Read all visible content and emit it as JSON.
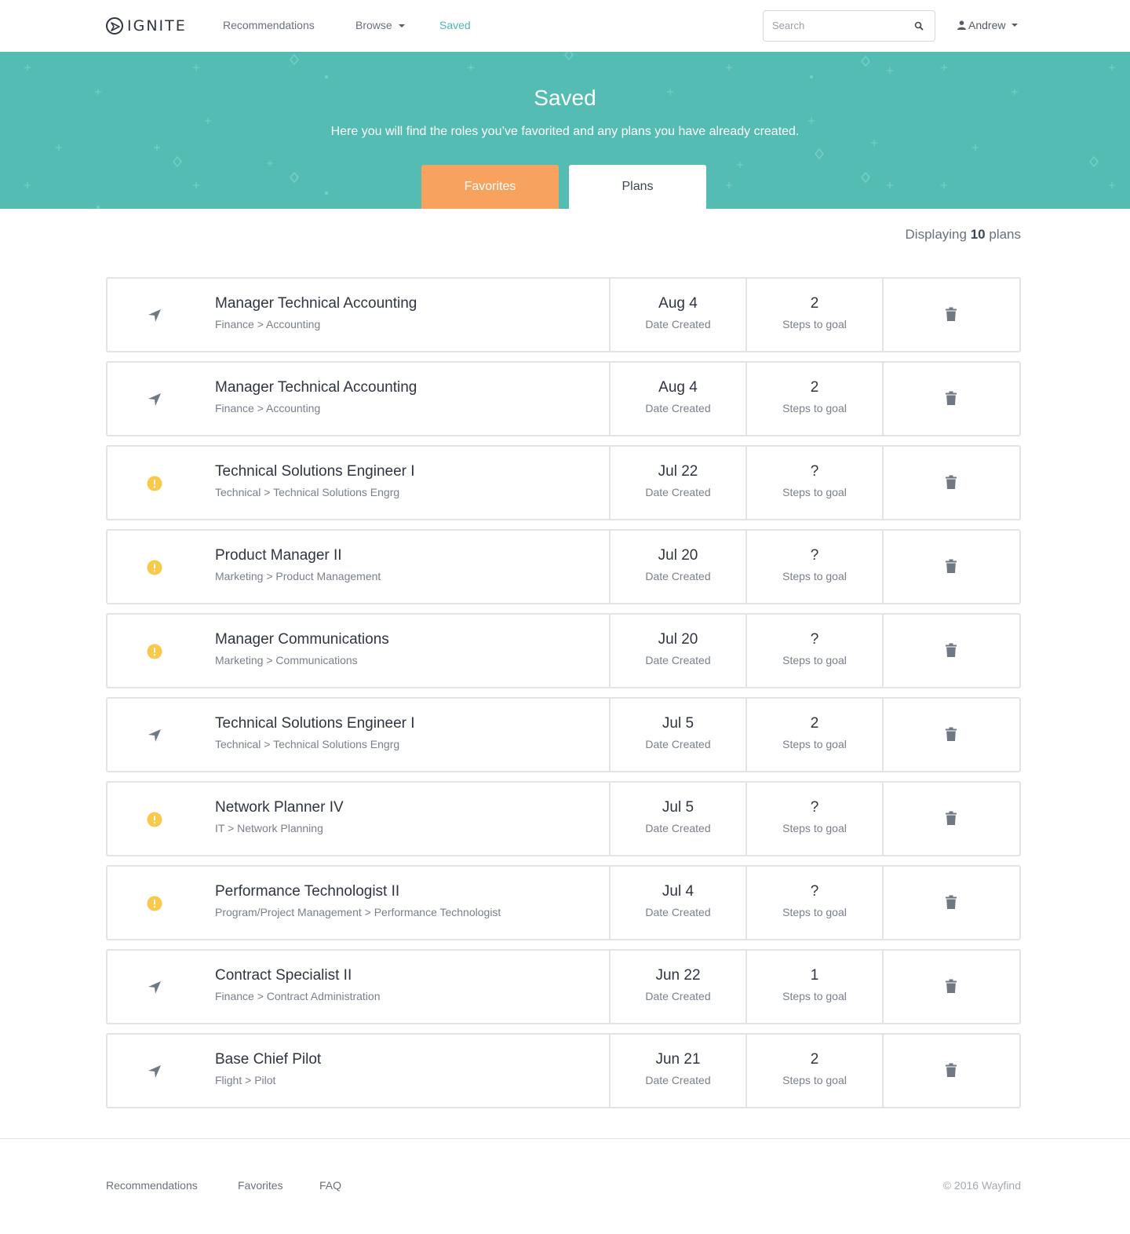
{
  "header": {
    "logo_text": "IGNITE",
    "nav": [
      {
        "label": "Recommendations"
      },
      {
        "label": "Browse"
      },
      {
        "label": "Saved"
      }
    ],
    "search_placeholder": "Search",
    "user_name": "Andrew"
  },
  "hero": {
    "title": "Saved",
    "subtitle": "Here you will find the roles you’ve favorited and any plans you have already created.",
    "tabs": [
      {
        "label": "Favorites",
        "active": false
      },
      {
        "label": "Plans",
        "active": true
      }
    ]
  },
  "summary": {
    "prefix": "Displaying",
    "count": "10",
    "suffix": "plans"
  },
  "plans": [
    {
      "status_icon": "navigation-arrow-icon",
      "title": "Manager Technical Accounting",
      "path": "Finance > Accounting",
      "date": "Aug 4",
      "date_label": "Date Created",
      "steps": "2",
      "steps_label": "Steps to goal"
    },
    {
      "status_icon": "navigation-arrow-icon",
      "title": "Manager Technical Accounting",
      "path": "Finance > Accounting",
      "date": "Aug 4",
      "date_label": "Date Created",
      "steps": "2",
      "steps_label": "Steps to goal"
    },
    {
      "status_icon": "warning-icon",
      "title": "Technical Solutions Engineer I",
      "path": "Technical > Technical Solutions Engrg",
      "date": "Jul 22",
      "date_label": "Date Created",
      "steps": "?",
      "steps_label": "Steps to goal"
    },
    {
      "status_icon": "warning-icon",
      "title": "Product Manager II",
      "path": "Marketing > Product Management",
      "date": "Jul 20",
      "date_label": "Date Created",
      "steps": "?",
      "steps_label": "Steps to goal"
    },
    {
      "status_icon": "warning-icon",
      "title": "Manager Communications",
      "path": "Marketing > Communications",
      "date": "Jul 20",
      "date_label": "Date Created",
      "steps": "?",
      "steps_label": "Steps to goal"
    },
    {
      "status_icon": "navigation-arrow-icon",
      "title": "Technical Solutions Engineer I",
      "path": "Technical > Technical Solutions Engrg",
      "date": "Jul 5",
      "date_label": "Date Created",
      "steps": "2",
      "steps_label": "Steps to goal"
    },
    {
      "status_icon": "warning-icon",
      "title": "Network Planner IV",
      "path": "IT > Network Planning",
      "date": "Jul 5",
      "date_label": "Date Created",
      "steps": "?",
      "steps_label": "Steps to goal"
    },
    {
      "status_icon": "warning-icon",
      "title": "Performance Technologist II",
      "path": "Program/Project Management > Performance Technologist",
      "date": "Jul 4",
      "date_label": "Date Created",
      "steps": "?",
      "steps_label": "Steps to goal"
    },
    {
      "status_icon": "navigation-arrow-icon",
      "title": "Contract Specialist II",
      "path": "Finance > Contract Administration",
      "date": "Jun 22",
      "date_label": "Date Created",
      "steps": "1",
      "steps_label": "Steps to goal"
    },
    {
      "status_icon": "navigation-arrow-icon",
      "title": "Base Chief Pilot",
      "path": "Flight > Pilot",
      "date": "Jun 21",
      "date_label": "Date Created",
      "steps": "2",
      "steps_label": "Steps to goal"
    }
  ],
  "footer": {
    "links": [
      {
        "label": "Recommendations"
      },
      {
        "label": "Favorites"
      },
      {
        "label": "FAQ"
      }
    ],
    "copyright": "© 2016 Wayfind"
  },
  "colors": {
    "accent_teal": "#55bcb3",
    "active_nav": "#4db8ad",
    "favorites_tab": "#f7a25f",
    "warning": "#f8c94a",
    "icon_gray": "#707884"
  }
}
